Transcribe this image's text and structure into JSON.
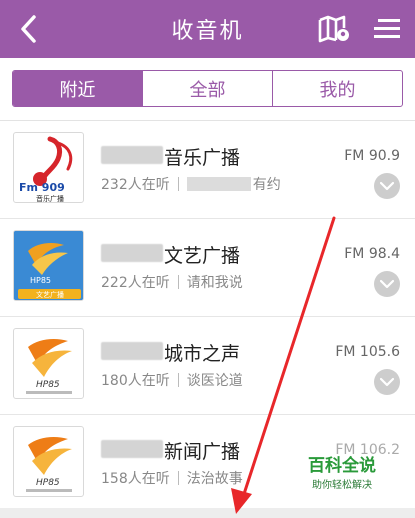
{
  "header": {
    "title": "收音机",
    "back_icon": "chevron-left-icon",
    "map_icon": "map-location-icon",
    "menu_icon": "menu-icon"
  },
  "tabs": [
    {
      "label": "附近",
      "active": true
    },
    {
      "label": "全部",
      "active": false
    },
    {
      "label": "我的",
      "active": false
    }
  ],
  "stations": [
    {
      "name": "音乐广播",
      "listeners": "232人在听",
      "program": "有约",
      "freq": "FM 90.9",
      "logo_text": "Fm 909",
      "logo_sub": "音乐广播"
    },
    {
      "name": "文艺广播",
      "listeners": "222人在听",
      "program": "请和我说",
      "freq": "FM 98.4",
      "logo_text": "HP85",
      "logo_sub": "文艺广播"
    },
    {
      "name": "城市之声",
      "listeners": "180人在听",
      "program": "谈医论道",
      "freq": "FM 105.6",
      "logo_text": "HP85"
    },
    {
      "name": "新闻广播",
      "listeners": "158人在听",
      "program": "法治故事",
      "freq": "FM 106.2",
      "logo_text": "HP85"
    }
  ],
  "watermark": {
    "title": "百科全说",
    "subtitle": "助你轻松解决"
  },
  "colors": {
    "accent": "#9a5aa8",
    "annotation": "#e8272a",
    "watermark": "#2a9a3a"
  }
}
